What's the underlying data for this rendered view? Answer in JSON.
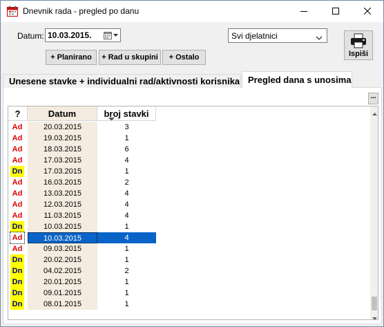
{
  "window": {
    "title": "Dnevnik rada - pregled po danu",
    "icon": "calendar-app-icon"
  },
  "filters": {
    "date_label": "Datum:",
    "date_value": "10.03.2015.",
    "employee_value": "Svi djelatnici"
  },
  "toolbar": {
    "planned_label": "+ Planirano",
    "group_work_label": "+ Rad u skupini",
    "other_label": "+ Ostalo",
    "print_label": "Ispiši"
  },
  "tabs": [
    {
      "label": "Unesene stavke + individualni rad/aktivnosti korisnika",
      "active": false
    },
    {
      "label": "Pregled dana s unosima",
      "active": true
    }
  ],
  "more_button_label": "...",
  "grid": {
    "columns": [
      "?",
      "Datum",
      "broj stavki"
    ],
    "rows": [
      {
        "type": "Ad",
        "date": "20.03.2015",
        "count": "3"
      },
      {
        "type": "Ad",
        "date": "19.03.2015",
        "count": "1"
      },
      {
        "type": "Ad",
        "date": "18.03.2015",
        "count": "6"
      },
      {
        "type": "Ad",
        "date": "17.03.2015",
        "count": "4"
      },
      {
        "type": "Dn",
        "date": "17.03.2015",
        "count": "1"
      },
      {
        "type": "Ad",
        "date": "16.03.2015",
        "count": "2"
      },
      {
        "type": "Ad",
        "date": "13.03.2015",
        "count": "4"
      },
      {
        "type": "Ad",
        "date": "12.03.2015",
        "count": "4"
      },
      {
        "type": "Ad",
        "date": "11.03.2015",
        "count": "4"
      },
      {
        "type": "Dn",
        "date": "10.03.2015",
        "count": "1"
      },
      {
        "type": "Ad",
        "date": "10.03.2015",
        "count": "4",
        "selected": true
      },
      {
        "type": "Ad",
        "date": "09.03.2015",
        "count": "1"
      },
      {
        "type": "Dn",
        "date": "20.02.2015",
        "count": "1"
      },
      {
        "type": "Dn",
        "date": "04.02.2015",
        "count": "2"
      },
      {
        "type": "Dn",
        "date": "20.01.2015",
        "count": "1"
      },
      {
        "type": "Dn",
        "date": "09.01.2015",
        "count": "1"
      },
      {
        "type": "Dn",
        "date": "08.01.2015",
        "count": "1"
      }
    ]
  },
  "colors": {
    "ad_text": "#e00000",
    "dn_background": "#ffff00",
    "selection": "#0a64c8",
    "date_column": "#f4ece0"
  }
}
